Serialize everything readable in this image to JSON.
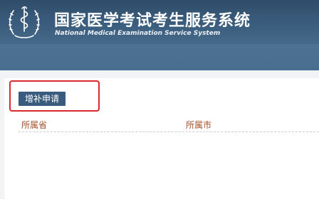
{
  "header": {
    "title_cn": "国家医学考试考生服务系统",
    "title_en": "National Medical Examination Service System",
    "logo_icon": "medical-emblem-icon"
  },
  "toolbar": {
    "supplement_apply_label": "增补申请"
  },
  "table": {
    "columns": [
      "所属省",
      "所属市"
    ]
  },
  "colors": {
    "header_bg": "#3b5d7d",
    "button_bg": "#395b7e",
    "highlight_border": "#d8292c",
    "column_text": "#a3512b"
  }
}
